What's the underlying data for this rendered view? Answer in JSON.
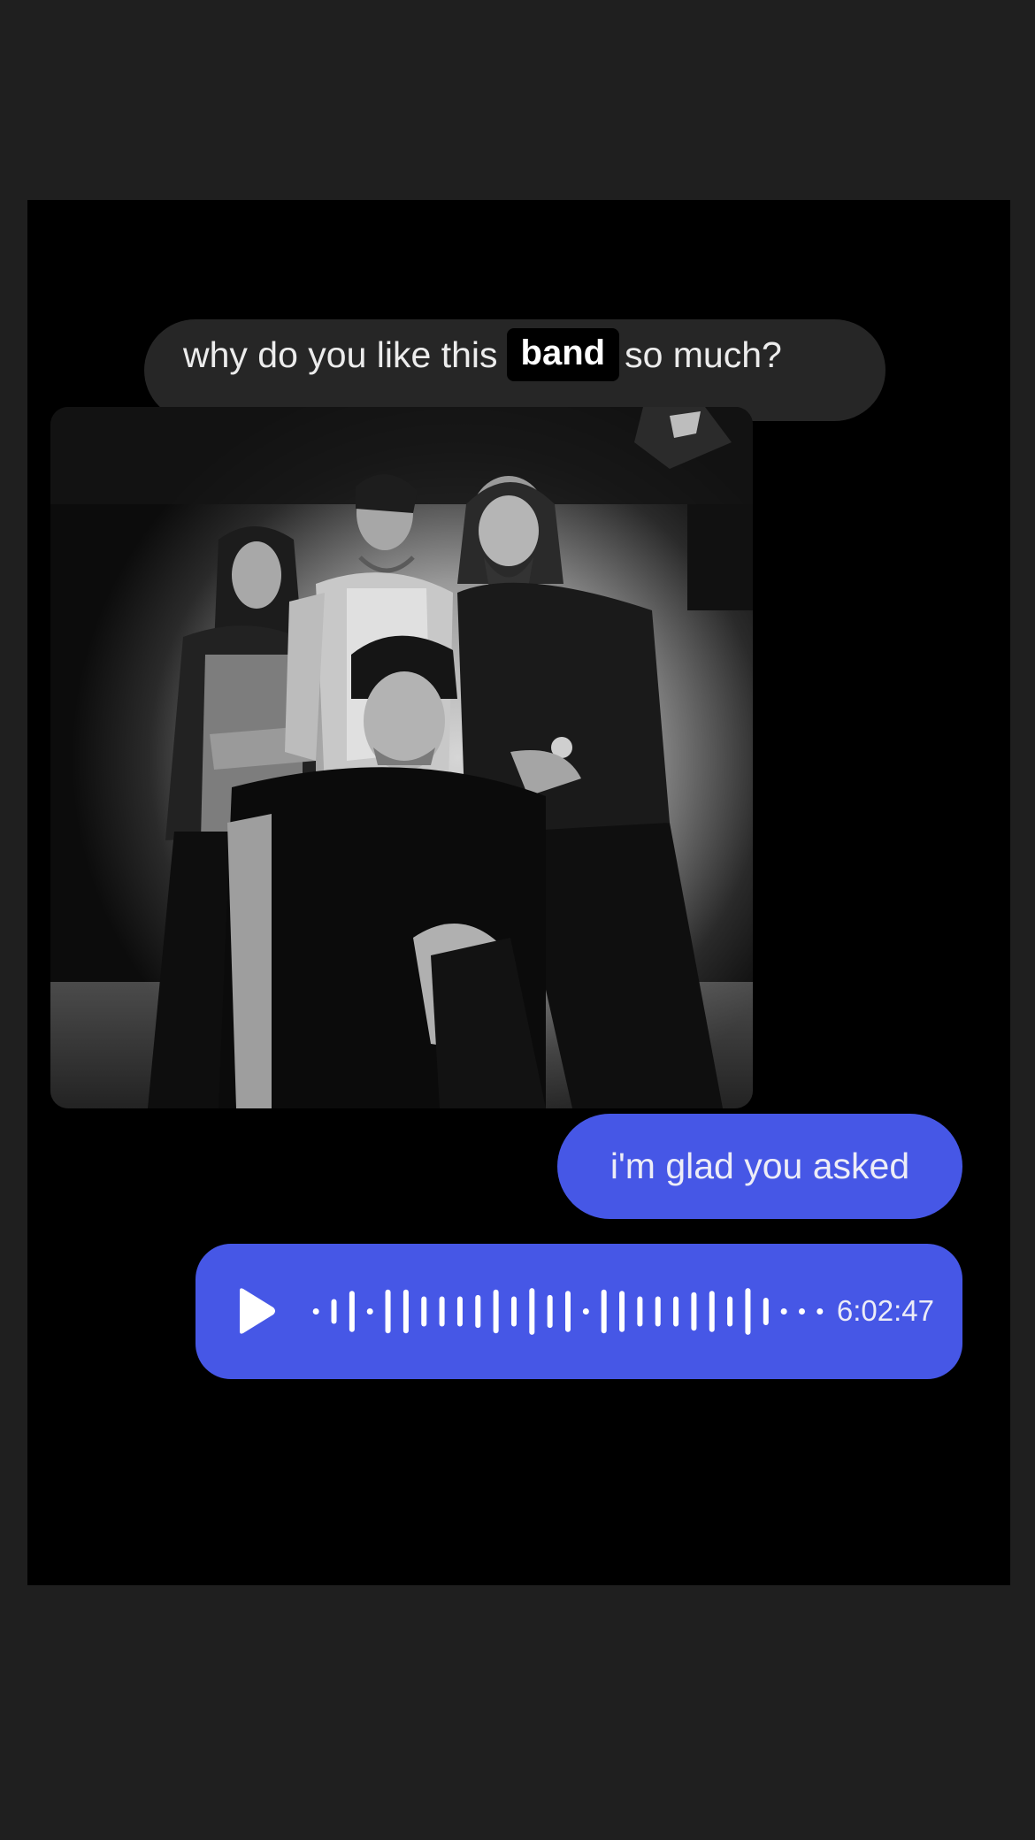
{
  "theme": {
    "page_background": "#1f1f1f",
    "card_background": "#000000",
    "incoming_bubble": "#262626",
    "outgoing_bubble": "#4657e6"
  },
  "messages": {
    "incoming": {
      "text_before": "why do you like this",
      "highlight": "band",
      "text_after": "so much?"
    },
    "photo": {
      "subject": "black-and-white group photo of four band members"
    },
    "outgoing": {
      "text": "i'm glad you asked"
    },
    "voice_note": {
      "play_icon": "play-icon",
      "duration": "6:02:47",
      "waveform_levels": [
        0.1,
        0.45,
        0.75,
        0.1,
        0.8,
        0.8,
        0.55,
        0.55,
        0.55,
        0.6,
        0.8,
        0.55,
        0.85,
        0.6,
        0.75,
        0.1,
        0.8,
        0.75,
        0.55,
        0.55,
        0.55,
        0.7,
        0.75,
        0.55,
        0.85,
        0.5,
        0.1,
        0.1,
        0.1
      ]
    }
  }
}
